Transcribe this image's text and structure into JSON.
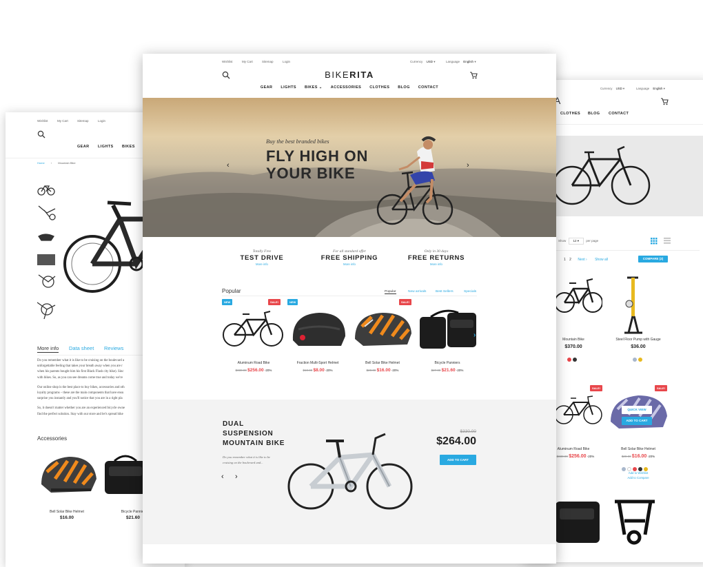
{
  "top_links": [
    "Wishlist",
    "My Cart",
    "Sitemap",
    "Login"
  ],
  "currency": {
    "label": "Currency",
    "value": "USD"
  },
  "language": {
    "label": "Language",
    "value": "English"
  },
  "brand": {
    "part1": "BIKE",
    "part2": "RITA"
  },
  "nav": [
    "GEAR",
    "LIGHTS",
    "BIKES",
    "ACCESSORIES",
    "CLOTHES",
    "BLOG",
    "CONTACT"
  ],
  "left_nav": [
    "GEAR",
    "LIGHTS",
    "BIKES"
  ],
  "right_nav": [
    "CLOTHES",
    "BLOG",
    "CONTACT"
  ],
  "right_logo_fragment": "A",
  "hero": {
    "subtitle": "Buy the best branded bikes",
    "title_line1": "FLY HIGH ON",
    "title_line2": "YOUR BIKE"
  },
  "features": [
    {
      "small": "Totally Free",
      "big": "TEST DRIVE",
      "link": "More info"
    },
    {
      "small": "For all standard offer",
      "big": "FREE SHIPPING",
      "link": "More info"
    },
    {
      "small": "Only in 30 days",
      "big": "FREE RETURNS",
      "link": "More info"
    }
  ],
  "popular": {
    "title": "Popular",
    "tabs": [
      "Popular",
      "New arrivals",
      "Best Sellers",
      "Specials"
    ],
    "products": [
      {
        "name": "Aluminum Road Bike",
        "old": "$330.00",
        "price": "$256.00",
        "disc": "-20%",
        "badges": [
          "NEW",
          "SALE!"
        ]
      },
      {
        "name": "Fraction Multi-Sport Helmet",
        "old": "$10.00",
        "price": "$8.00",
        "disc": "-20%",
        "badges": [
          "NEW"
        ]
      },
      {
        "name": "Bell Solar Bike Helmet",
        "old": "$20.00",
        "price": "$16.00",
        "disc": "-20%",
        "badges": [
          "SALE!"
        ]
      },
      {
        "name": "Bicycle Panniers",
        "old": "$27.00",
        "price": "$21.60",
        "disc": "-20%",
        "badges": []
      }
    ]
  },
  "promo": {
    "title_l1": "DUAL",
    "title_l2": "SUSPENSION",
    "title_l3": "MOUNTAIN BIKE",
    "desc_l1": "Do you remember what it is like to be",
    "desc_l2": "cruising on the boulevard and...",
    "old": "$330.00",
    "price": "$264.00",
    "button": "ADD TO CART"
  },
  "left_page": {
    "breadcrumb": [
      "Home",
      "Mountain Bike"
    ],
    "tabs": [
      "More info",
      "Data sheet",
      "Reviews"
    ],
    "paragraphs": [
      [
        "Do you remember what it is like to be cruising on the boulevard a",
        "unforgettable feeling that takes your breath away when you are r",
        "when his parents bought him his first Black Flash city bike). Sinc",
        "with bikes. So, as you can see dreams come true and today we're"
      ],
      [
        "Our online shop is the best place to buy bikes, accessories and oth",
        "loyalty programs – these are the main components that have ensu",
        "surprise you instantly and you'll notice that you are in a right pla"
      ],
      [
        "So, it doesn't matter whether you are an experienced bicycle owne",
        "find the perfect solution. Stay with our store and let's spread bike"
      ]
    ],
    "accessories_title": "Accessories",
    "accessories": [
      {
        "name": "Bell Solar Bike Helmet",
        "price": "$16.00"
      },
      {
        "name": "Bicycle Pannier",
        "price": "$21.60"
      }
    ]
  },
  "right_page": {
    "show_label": "Show",
    "show_value": "12",
    "per_page": "per page",
    "pages": [
      "1",
      "2"
    ],
    "next": "Next",
    "show_all": "Show all",
    "compare": "COMPARE (2)",
    "products": [
      {
        "name": "Mountain Bike",
        "price": "$370.00"
      },
      {
        "name": "Steel Floor Pump with Gauge",
        "price": "$36.00"
      },
      {
        "name": "Aluminum Road Bike",
        "old": "$330.00",
        "price": "$256.00",
        "disc": "-20%",
        "badge": "SALE!"
      },
      {
        "name": "Bell Solar Bike Helmet",
        "old": "$20.00",
        "price": "$16.00",
        "disc": "-20%",
        "badge": "SALE!"
      }
    ],
    "quick_view": "QUICK VIEW",
    "add_to_cart": "ADD TO CART",
    "wishlist": "Add to Wishlist",
    "compare_link": "Add to Compare"
  },
  "colors": {
    "accent": "#29a9e1",
    "sale": "#e8474b",
    "text": "#222222"
  }
}
